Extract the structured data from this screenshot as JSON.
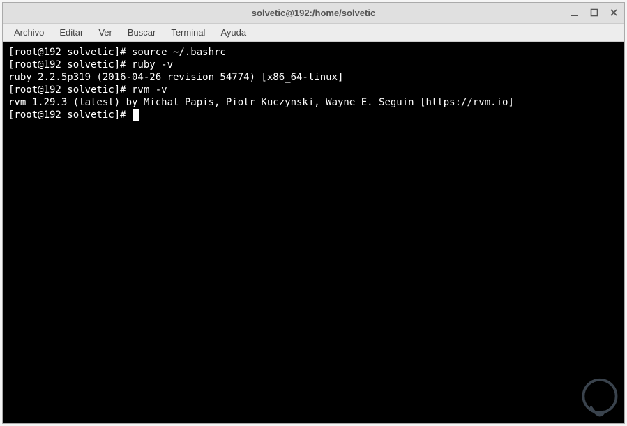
{
  "window": {
    "title": "solvetic@192:/home/solvetic"
  },
  "menubar": {
    "items": [
      "Archivo",
      "Editar",
      "Ver",
      "Buscar",
      "Terminal",
      "Ayuda"
    ]
  },
  "terminal": {
    "lines": [
      "[root@192 solvetic]# source ~/.bashrc",
      "[root@192 solvetic]# ruby -v",
      "ruby 2.2.5p319 (2016-04-26 revision 54774) [x86_64-linux]",
      "[root@192 solvetic]# rvm -v",
      "rvm 1.29.3 (latest) by Michal Papis, Piotr Kuczynski, Wayne E. Seguin [https://rvm.io]",
      "[root@192 solvetic]# "
    ]
  }
}
